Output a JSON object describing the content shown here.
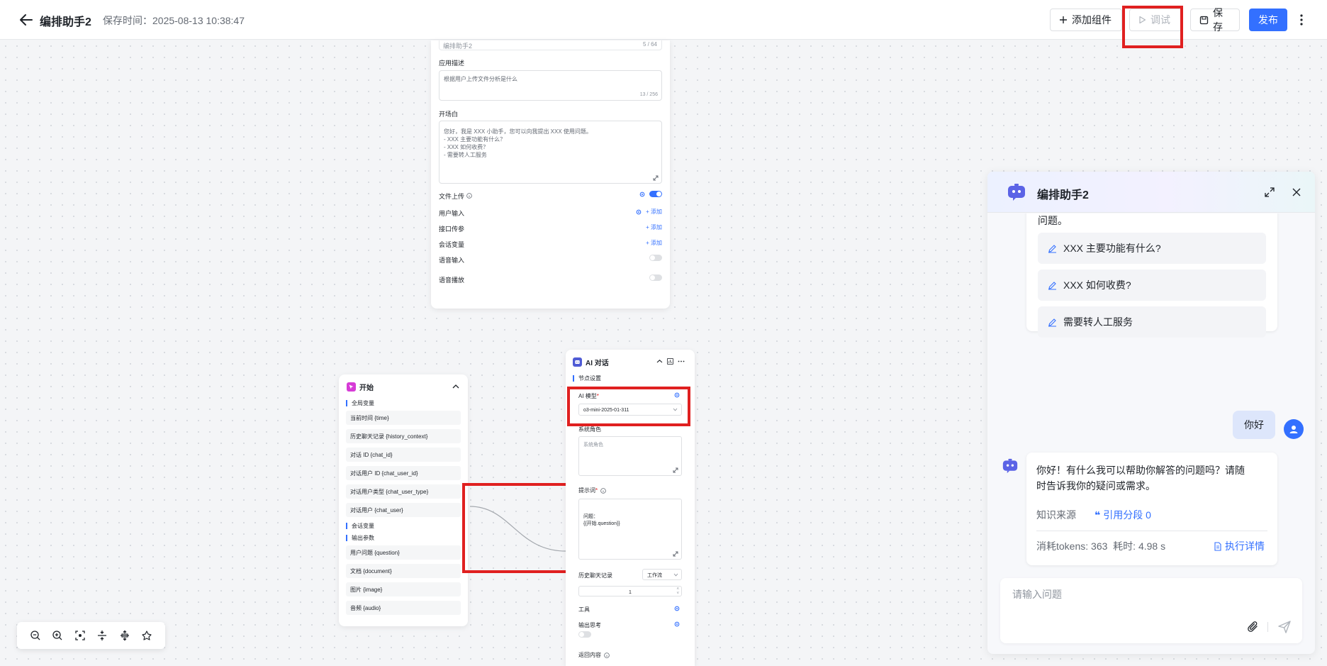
{
  "header": {
    "title": "编排助手2",
    "save_time_label": "保存时间：",
    "save_time": "2025-08-13 10:38:47",
    "add_component": "添加组件",
    "debug": "调试",
    "save": "保存",
    "publish": "发布"
  },
  "base_node": {
    "name_value": "编排助手2",
    "name_count": "5 / 64",
    "desc_label": "应用描述",
    "desc_value": "根据用户上传文件分析是什么",
    "desc_count": "13 / 256",
    "opening_label": "开场白",
    "opening_lines": [
      "您好，我是 XXX 小助手，您可以向我提出 XXX 使用问题。",
      "- XXX 主要功能有什么？",
      "- XXX 如何收费？",
      "- 需要转人工服务"
    ],
    "file_upload": "文件上传",
    "user_input": "用户输入",
    "api_params": "接口传参",
    "session_vars": "会话变量",
    "add": "添加",
    "voice_input": "语音输入",
    "voice_play": "语音播放"
  },
  "start_node": {
    "title": "开始",
    "global_vars_label": "全局变量",
    "global_vars": [
      "当前时间 {time}",
      "历史聊天记录 {history_context}",
      "对话 ID {chat_id}",
      "对话用户 ID {chat_user_id}",
      "对话用户类型 {chat_user_type}",
      "对话用户 {chat_user}"
    ],
    "session_vars_label": "会话变量",
    "output_params_label": "输出参数",
    "output_params": [
      "用户问题 {question}",
      "文档 {document}",
      "图片 {image}",
      "音频 {audio}"
    ]
  },
  "ai_node": {
    "title": "AI 对话",
    "section": "节点设置",
    "model_label": "AI 模型",
    "model_value": "o3-mini-2025-01-311",
    "system_role_label": "系统角色",
    "system_role_placeholder": "系统角色",
    "prompt_label": "提示词",
    "prompt_lines": [
      "问题：",
      "{{开始.question}}"
    ],
    "history_label": "历史聊天记录",
    "history_mode": "工作流",
    "history_count": "1",
    "tools_label": "工具",
    "output_thinking_label": "输出思考",
    "return_content_label": "返回内容"
  },
  "chat": {
    "title": "编排助手2",
    "partial_text": "问题。",
    "suggestions": [
      "XXX 主要功能有什么?",
      "XXX 如何收费?",
      "需要转人工服务"
    ],
    "user_message": "你好",
    "answer": "你好！有什么我可以帮助你解答的问题吗？请随时告诉我你的疑问或需求。",
    "knowledge_source": "知识来源",
    "citation": "引用分段 0",
    "tokens": "消耗tokens: 363",
    "elapsed": "耗时: 4.98 s",
    "exec_detail": "执行详情",
    "input_placeholder": "请输入问题"
  },
  "colors": {
    "primary": "#3370ff",
    "highlight": "#e02020",
    "start_icon": "#d63bd6",
    "ai_icon": "#4f5bd5"
  }
}
